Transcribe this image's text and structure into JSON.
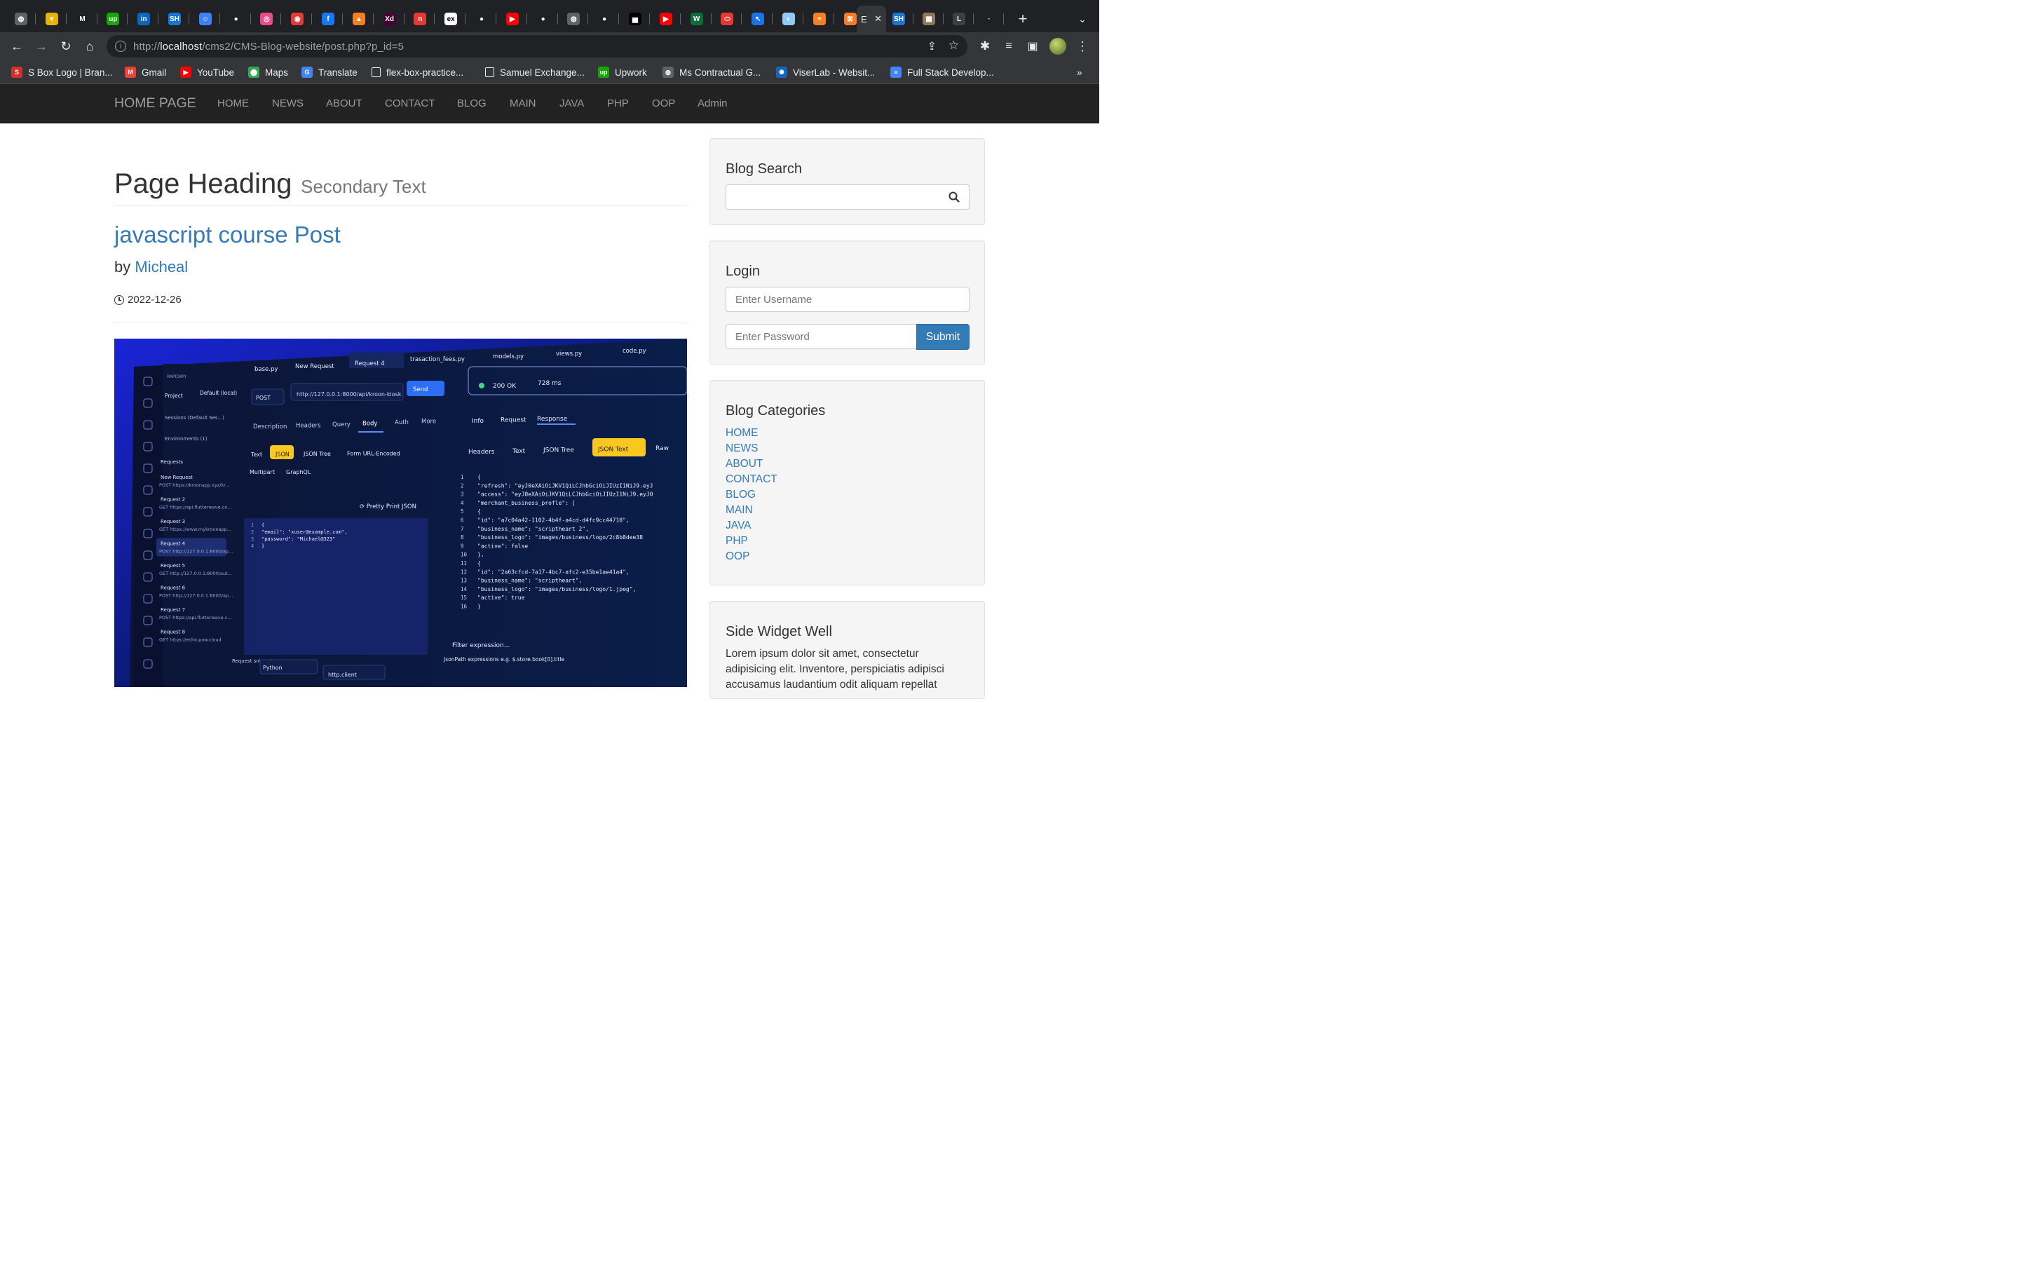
{
  "browser": {
    "active_tab_label": "E",
    "url_prefix": "http://",
    "url_host": "localhost",
    "url_path": "/cms2/CMS-Blog-website/post.php?p_id=5",
    "tabs": [
      {
        "icon": "globe-icon",
        "color": "#5f6368",
        "glyph": "◍"
      },
      {
        "icon": "shield-favicon",
        "color": "#e8b400",
        "glyph": "▾"
      },
      {
        "icon": "medium-favicon",
        "color": "#202124",
        "glyph": "M"
      },
      {
        "icon": "upwork-favicon",
        "color": "#14a800",
        "glyph": "up"
      },
      {
        "icon": "linkedin-favicon",
        "color": "#0a66c2",
        "glyph": "in"
      },
      {
        "icon": "sh-favicon",
        "color": "#1976d2",
        "glyph": "SH"
      },
      {
        "icon": "smile-favicon",
        "color": "#3b82f6",
        "glyph": "☺"
      },
      {
        "icon": "github-favicon",
        "color": "#202124",
        "glyph": "●"
      },
      {
        "icon": "dribbble-favicon",
        "color": "#ea4c89",
        "glyph": "◎"
      },
      {
        "icon": "target-favicon",
        "color": "#e53935",
        "glyph": "◉"
      },
      {
        "icon": "facebook-favicon",
        "color": "#1877f2",
        "glyph": "f"
      },
      {
        "icon": "stack-favicon",
        "color": "#f48024",
        "glyph": "▲"
      },
      {
        "icon": "xd-favicon",
        "color": "#470137",
        "glyph": "Xd"
      },
      {
        "icon": "readme-favicon",
        "color": "#e53935",
        "glyph": "n"
      },
      {
        "icon": "ex-favicon",
        "color": "#ffffff",
        "glyph": "ex"
      },
      {
        "icon": "github-favicon-2",
        "color": "#202124",
        "glyph": "●"
      },
      {
        "icon": "youtube-favicon",
        "color": "#ff0000",
        "glyph": "▶"
      },
      {
        "icon": "github-favicon-3",
        "color": "#202124",
        "glyph": "●"
      },
      {
        "icon": "globe-icon-2",
        "color": "#5f6368",
        "glyph": "◍"
      },
      {
        "icon": "github-favicon-4",
        "color": "#202124",
        "glyph": "●"
      },
      {
        "icon": "unsplash-favicon",
        "color": "#000000",
        "glyph": "▅"
      },
      {
        "icon": "youtube-favicon-2",
        "color": "#ff0000",
        "glyph": "▶"
      },
      {
        "icon": "w-favicon",
        "color": "#0d6e3a",
        "glyph": "W"
      },
      {
        "icon": "pill-favicon",
        "color": "#e53935",
        "glyph": "⬭"
      },
      {
        "icon": "cursor-favicon",
        "color": "#1a73e8",
        "glyph": "↖"
      },
      {
        "icon": "chat-favicon",
        "color": "#90caf9",
        "glyph": "◐"
      },
      {
        "icon": "stackoverflow-favicon",
        "color": "#f48024",
        "glyph": "≡"
      },
      {
        "icon": "xampp-favicon",
        "color": "#fb7a24",
        "glyph": "⊠"
      }
    ],
    "tabs_after": [
      {
        "icon": "sh-favicon-2",
        "color": "#1976d2",
        "glyph": "SH"
      },
      {
        "icon": "photo-favicon",
        "color": "#8a7a5a",
        "glyph": "▦"
      },
      {
        "icon": "blank-favicon",
        "color": "#3c4043",
        "glyph": "L"
      },
      {
        "icon": "dot-favicon",
        "color": "#202124",
        "glyph": "·"
      }
    ],
    "bookmarks": [
      {
        "label": "S Box Logo | Bran...",
        "icon": "sbox-bookmark-icon",
        "color": "#d32f2f",
        "glyph": "S"
      },
      {
        "label": "Gmail",
        "icon": "gmail-bookmark-icon",
        "color": "#ea4335",
        "glyph": "M"
      },
      {
        "label": "YouTube",
        "icon": "youtube-bookmark-icon",
        "color": "#ff0000",
        "glyph": "▶"
      },
      {
        "label": "Maps",
        "icon": "maps-bookmark-icon",
        "color": "#34a853",
        "glyph": "⬤"
      },
      {
        "label": "Translate",
        "icon": "translate-bookmark-icon",
        "color": "#4285f4",
        "glyph": "G"
      },
      {
        "label": "flex-box-practice...",
        "icon": "page-bookmark-icon",
        "color": "transparent",
        "glyph": ""
      },
      {
        "label": "Samuel Exchange...",
        "icon": "page-bookmark-icon-2",
        "color": "transparent",
        "glyph": ""
      },
      {
        "label": "Upwork",
        "icon": "upwork-bookmark-icon",
        "color": "#14a800",
        "glyph": "up"
      },
      {
        "label": "Ms Contractual G...",
        "icon": "globe-bookmark-icon",
        "color": "#5f6368",
        "glyph": "◍"
      },
      {
        "label": "ViserLab - Websit...",
        "icon": "viserlab-bookmark-icon",
        "color": "#1565c0",
        "glyph": "✺"
      },
      {
        "label": "Full Stack Develop...",
        "icon": "docs-bookmark-icon",
        "color": "#4285f4",
        "glyph": "≡"
      }
    ],
    "more_bookmarks": "»"
  },
  "site": {
    "brand": "HOME PAGE",
    "nav": [
      "HOME",
      "NEWS",
      "ABOUT",
      "CONTACT",
      "BLOG",
      "MAIN",
      "JAVA",
      "PHP",
      "OOP",
      "Admin"
    ]
  },
  "main": {
    "heading": "Page Heading",
    "subheading": "Secondary Text",
    "post_title": "javascript course Post",
    "by": "by",
    "author": "Micheal",
    "date": "2022-12-26"
  },
  "sidebar": {
    "search_title": "Blog Search",
    "login_title": "Login",
    "username_placeholder": "Enter Username",
    "password_placeholder": "Enter Password",
    "submit_label": "Submit",
    "categories_title": "Blog Categories",
    "categories": [
      "HOME",
      "NEWS",
      "ABOUT",
      "CONTACT",
      "BLOG",
      "MAIN",
      "JAVA",
      "PHP",
      "OOP"
    ],
    "widget_title": "Side Widget Well",
    "widget_text": "Lorem ipsum dolor sit amet, consectetur adipisicing elit. Inventore, perspiciatis adipisci accusamus laudantium odit aliquam repellat"
  },
  "post_image": {
    "tabs": [
      "base.py",
      "New Request",
      "Request 4",
      "trasaction_fees.py",
      "models.py",
      "views.py",
      "code.py"
    ],
    "project_label": "Project",
    "project_value": "Default (local)",
    "brand_small": "RAPIDAPI",
    "sessions": "Sessions (Default Ses...)",
    "environments": "Environments (1)",
    "requests_label": "Requests",
    "request_list": [
      {
        "name": "New Request",
        "url": "POST https://kroonapp.xyz/kr..."
      },
      {
        "name": "Request 2",
        "url": "GET https://api.flutterwave.co..."
      },
      {
        "name": "Request 3",
        "url": "GET https://www.mykroonapp..."
      },
      {
        "name": "Request 4",
        "url": "POST http://127.0.0.1:8000/ap..."
      },
      {
        "name": "Request 5",
        "url": "GET http://127.0.0.1:8000/aut..."
      },
      {
        "name": "Request 6",
        "url": "POST http://127.0.0.1:8000/ap..."
      },
      {
        "name": "Request 7",
        "url": "POST https://api.flutterwave.c..."
      },
      {
        "name": "Request 8",
        "url": "GET https://echo.paw.cloud"
      }
    ],
    "method": "POST",
    "request_url": "http://127.0.0.1:8000/api/kroon-kiosk",
    "send": "Send",
    "req_tabs": [
      "Description",
      "Headers",
      "Query",
      "Body",
      "Auth",
      "More"
    ],
    "body_types": [
      "Text",
      "JSON",
      "JSON Tree",
      "Form URL-Encoded"
    ],
    "body_types2": [
      "Multipart",
      "GraphQL"
    ],
    "pretty_print": "Pretty Print JSON",
    "req_body": [
      "{",
      "  \"email\": \"xuser@example.com\",",
      "  \"password\": \"Michael@323\"",
      "}"
    ],
    "status": "200 OK",
    "time": "728 ms",
    "resp_tabs": [
      "Info",
      "Request",
      "Response"
    ],
    "resp_views": [
      "Headers",
      "Text",
      "JSON Tree",
      "JSON Text",
      "Raw"
    ],
    "response_lines": [
      "{",
      "  \"refresh\": \"eyJ0eXAiOiJKV1QiLCJhbGciOiJIUzI1NiJ9.eyJ",
      "  \"access\": \"eyJ0eXAiOiJKV1QiLCJhbGciOiJIUzI1NiJ9.eyJ0",
      "  \"merchant_business_profle\": [",
      "    {",
      "      \"id\": \"a7c04a42-1102-4b4f-a4cd-d4fc9cc44710\",",
      "      \"business_name\": \"scriptheart 2\",",
      "      \"business_logo\": \"images/business/logo/2c8b8dee38",
      "      \"active\": false",
      "    },",
      "    {",
      "      \"id\": \"2a63cfcd-7a17-4bc7-afc2-e35be1ae41a4\",",
      "      \"business_name\": \"scriptheart\",",
      "      \"business_logo\": \"images/business/logo/1.jpeg\",",
      "      \"active\": true",
      "    }"
    ],
    "filter": "Filter expression...",
    "jsonpath": "JsonPath expressions e.g. $.store.book[0].title",
    "snippet_label": "Request snippet",
    "snippet_lang": "Python",
    "snippet_lib": "http.client"
  }
}
